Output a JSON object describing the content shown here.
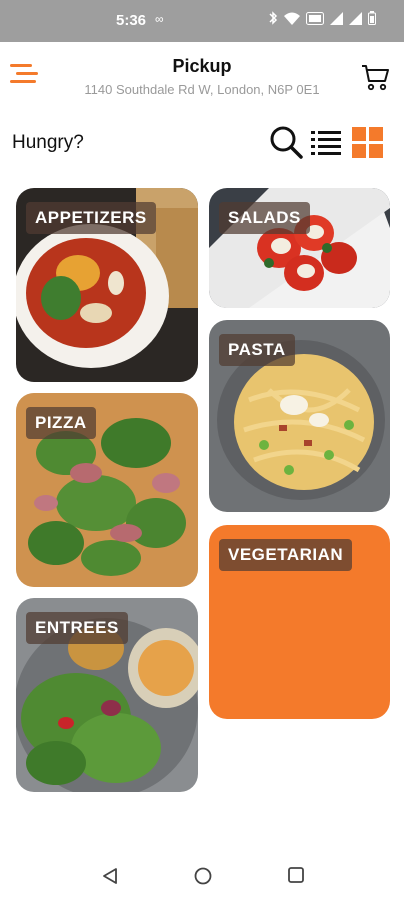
{
  "status_bar": {
    "time": "5:36",
    "extra": "∞",
    "icons": [
      "bluetooth-icon",
      "wifi-icon",
      "volte-icon",
      "signal-icon",
      "signal-icon",
      "battery-icon"
    ]
  },
  "header": {
    "title": "Pickup",
    "address": "1140 Southdale Rd W, London, N6P 0E1"
  },
  "greeting": "Hungry?",
  "colors": {
    "accent": "#f47a2b",
    "status_bar": "#9e9e9e",
    "label_bg": "rgba(80,60,50,0.72)",
    "address_text": "#9a9a9a"
  },
  "categories": [
    {
      "label": "APPETIZERS"
    },
    {
      "label": "SALADS"
    },
    {
      "label": "PASTA"
    },
    {
      "label": "PIZZA"
    },
    {
      "label": "VEGETARIAN"
    },
    {
      "label": "ENTREES"
    }
  ]
}
